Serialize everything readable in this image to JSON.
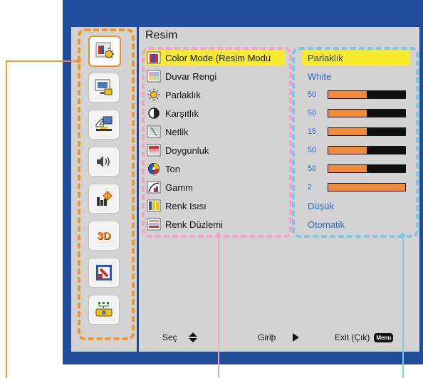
{
  "panel": {
    "title": "Resim"
  },
  "sidebar": {
    "tabs": [
      {
        "icon": "picture-icon",
        "selected": true
      },
      {
        "icon": "screen-icon",
        "selected": false
      },
      {
        "icon": "setting-icon",
        "selected": false
      },
      {
        "icon": "volume-icon",
        "selected": false
      },
      {
        "icon": "options-icon",
        "selected": false
      },
      {
        "icon": "3d-icon",
        "label": "3D",
        "selected": false
      },
      {
        "icon": "lan-icon",
        "selected": false
      },
      {
        "icon": "network-icon",
        "selected": false
      }
    ]
  },
  "menu": {
    "items": [
      {
        "label": "Color Mode (Resim Modu",
        "icon": "color-mode-icon",
        "selected": true
      },
      {
        "label": "Duvar Rengi",
        "icon": "wall-color-icon"
      },
      {
        "label": "Parlaklık",
        "icon": "brightness-icon"
      },
      {
        "label": "Karşıtlık",
        "icon": "contrast-icon"
      },
      {
        "label": "Netlik",
        "icon": "sharpness-icon"
      },
      {
        "label": "Doygunluk",
        "icon": "saturation-icon"
      },
      {
        "label": "Ton",
        "icon": "tint-icon"
      },
      {
        "label": "Gamm",
        "icon": "gamma-icon"
      },
      {
        "label": "Renk Isısı",
        "icon": "color-temp-icon"
      },
      {
        "label": "Renk Düzlemi",
        "icon": "color-space-icon"
      }
    ]
  },
  "values": {
    "items": [
      {
        "type": "text",
        "text": "Parlaklık",
        "selected": true
      },
      {
        "type": "text",
        "text": "White"
      },
      {
        "type": "slider",
        "num": "50",
        "level": 0.5
      },
      {
        "type": "slider",
        "num": "50",
        "level": 0.5
      },
      {
        "type": "slider",
        "num": "15",
        "level": 0.5
      },
      {
        "type": "slider",
        "num": "50",
        "level": 0.5
      },
      {
        "type": "slider",
        "num": "50",
        "level": 0.5
      },
      {
        "type": "slider",
        "num": "2",
        "level": 1.0
      },
      {
        "type": "text",
        "text": "Düşük"
      },
      {
        "type": "text",
        "text": "Otomatik"
      }
    ]
  },
  "footer": {
    "select_label": "Seç",
    "enter_label": "Giriþ",
    "exit_label": "Exit (Çık)",
    "menu_key": "Menu"
  },
  "colors": {
    "frame": "#1f4d9c",
    "highlight": "#f8ea2c",
    "value_text": "#2b67c9",
    "bar_fill": "#f08a3b",
    "callout_orange": "#f0962e",
    "callout_pink": "#f4a4c6",
    "callout_blue": "#82c6ea"
  }
}
